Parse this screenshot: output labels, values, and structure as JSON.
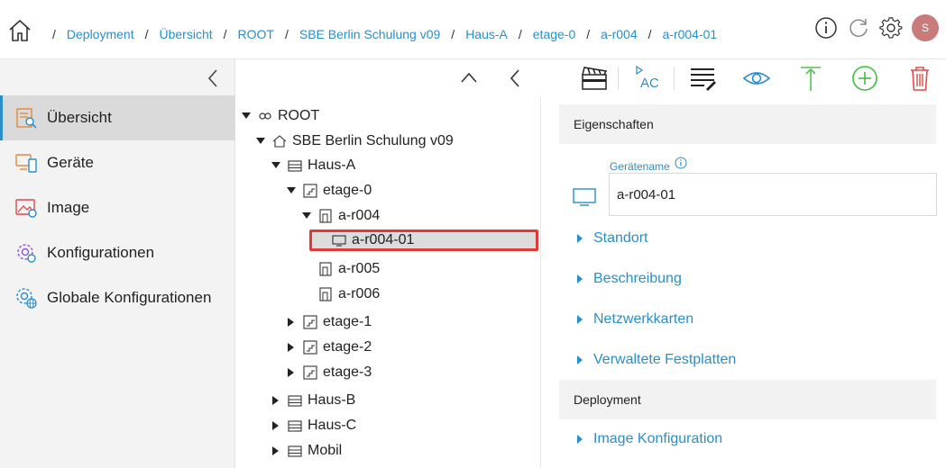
{
  "breadcrumbs": [
    "Deployment",
    "Übersicht",
    "ROOT",
    "SBE Berlin Schulung v09",
    "Haus-A",
    "etage-0",
    "a-r004",
    "a-r004-01"
  ],
  "user": {
    "initial": "S"
  },
  "colors": {
    "accent": "#2a8fc8",
    "selection_border": "#e03a36",
    "add_green": "#3fbf3f",
    "delete_red": "#e24a43"
  },
  "sidebar": {
    "items": [
      {
        "label": "Übersicht",
        "icon": "overview-icon",
        "active": true
      },
      {
        "label": "Geräte",
        "icon": "devices-icon"
      },
      {
        "label": "Image",
        "icon": "image-icon"
      },
      {
        "label": "Konfigurationen",
        "icon": "config-icon"
      },
      {
        "label": "Globale Konfigurationen",
        "icon": "global-config-icon"
      }
    ]
  },
  "tree": {
    "nodes": [
      {
        "label": "ROOT",
        "icon": "root-icon"
      },
      {
        "label": "SBE Berlin Schulung v09",
        "icon": "home-icon"
      },
      {
        "label": "Haus-A",
        "icon": "building-icon"
      },
      {
        "label": "etage-0",
        "icon": "floor-icon"
      },
      {
        "label": "a-r004",
        "icon": "room-icon"
      },
      {
        "label": "a-r004-01",
        "icon": "monitor-icon",
        "selected": true
      },
      {
        "label": "a-r005",
        "icon": "room-icon"
      },
      {
        "label": "a-r006",
        "icon": "room-icon"
      },
      {
        "label": "etage-1",
        "icon": "floor-icon"
      },
      {
        "label": "etage-2",
        "icon": "floor-icon"
      },
      {
        "label": "etage-3",
        "icon": "floor-icon"
      },
      {
        "label": "Haus-B",
        "icon": "building-icon"
      },
      {
        "label": "Haus-C",
        "icon": "building-icon"
      },
      {
        "label": "Mobil",
        "icon": "building-icon"
      }
    ]
  },
  "panel": {
    "properties_header": "Eigenschaften",
    "device_name_label": "Gerätename",
    "device_name_value": "a-r004-01",
    "expanders": [
      "Standort",
      "Beschreibung",
      "Netzwerkkarten",
      "Verwaltete Festplatten"
    ],
    "deployment_header": "Deployment",
    "deployment_expanders": [
      "Image Konfiguration"
    ]
  }
}
